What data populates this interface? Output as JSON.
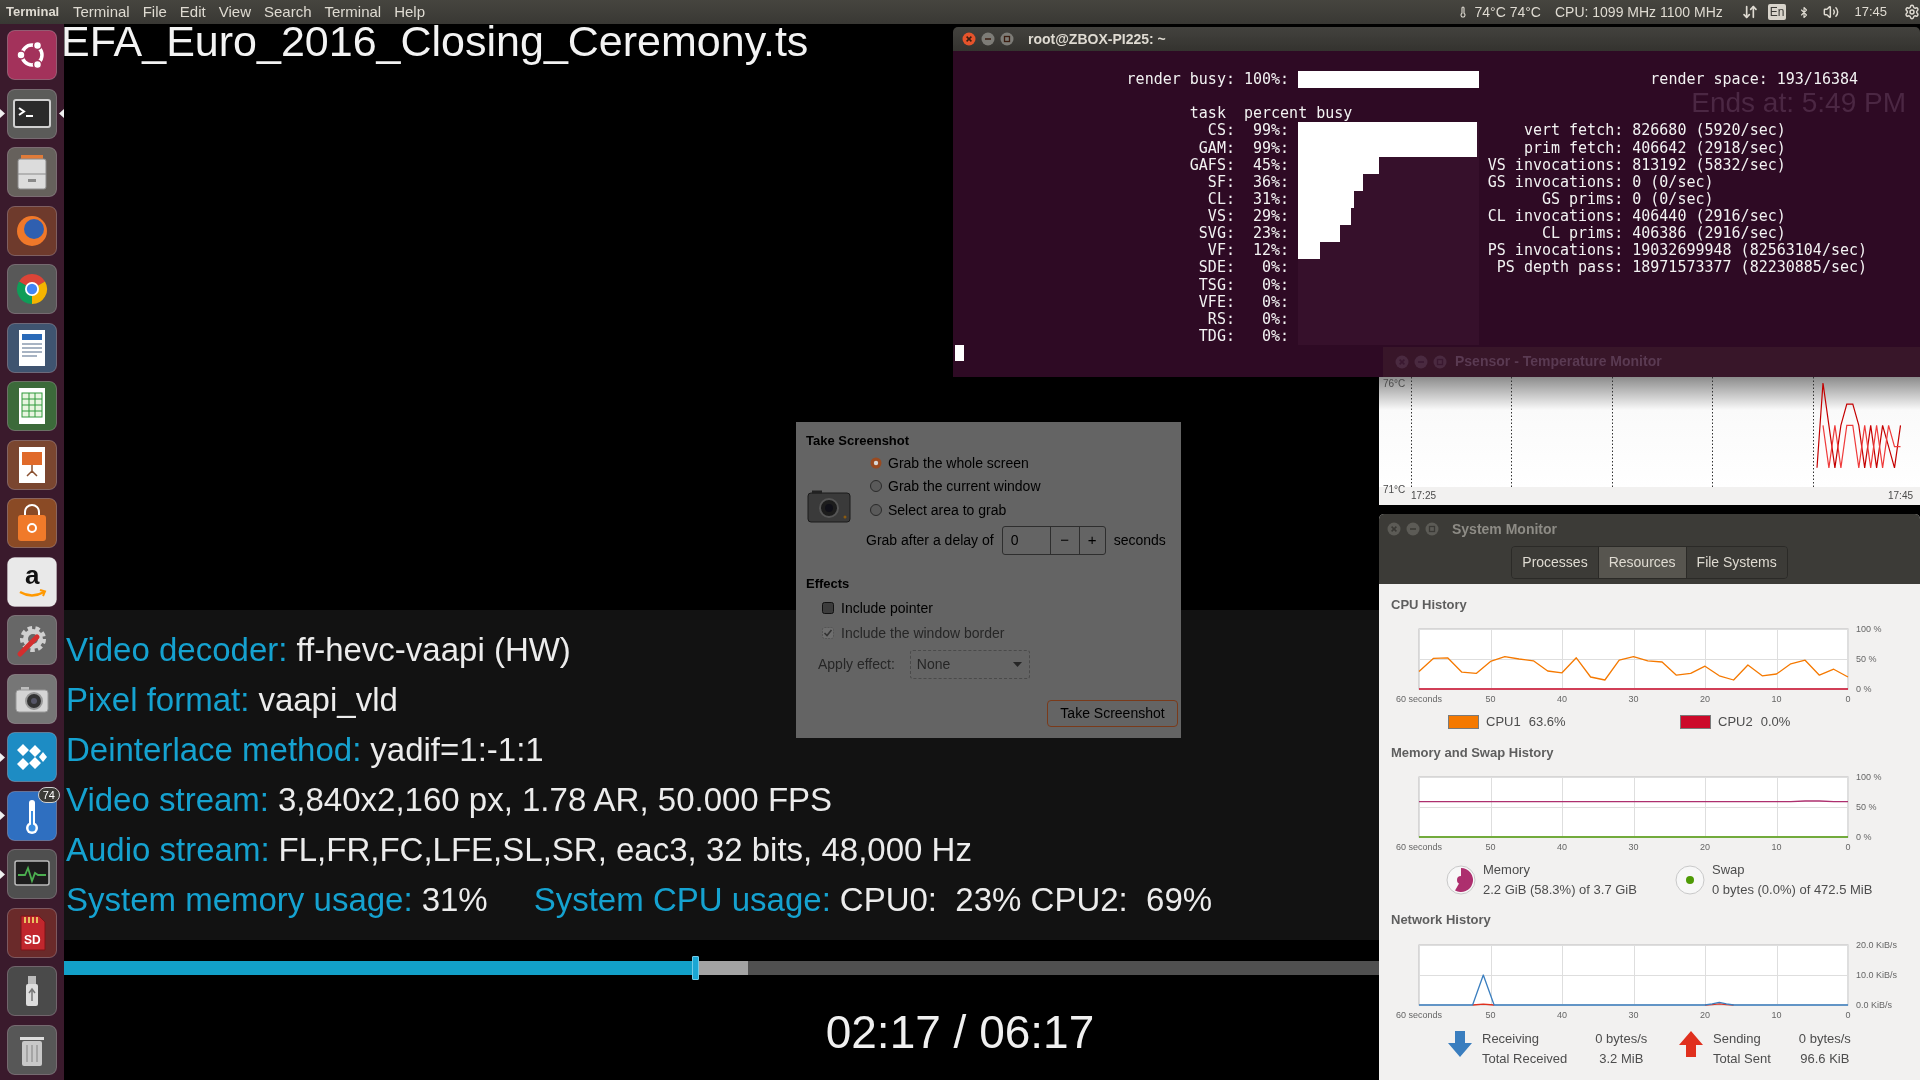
{
  "top_bar": {
    "app_name": "Terminal",
    "menus": [
      "Terminal",
      "File",
      "Edit",
      "View",
      "Search",
      "Terminal",
      "Help"
    ],
    "temperature": "74°C 74°C",
    "cpu_frequency": "CPU: 1099 MHz 1100 MHz",
    "keyboard_layout": "En",
    "clock": "17:45"
  },
  "dock": {
    "items": [
      {
        "kind": "dash",
        "running": false,
        "focused": false
      },
      {
        "kind": "terminal",
        "running": true,
        "focused": true
      },
      {
        "kind": "files",
        "running": false,
        "focused": false
      },
      {
        "kind": "firefox",
        "running": false,
        "focused": false
      },
      {
        "kind": "chrome",
        "running": false,
        "focused": false
      },
      {
        "kind": "writer",
        "running": false,
        "focused": false
      },
      {
        "kind": "calc",
        "running": false,
        "focused": false
      },
      {
        "kind": "impress",
        "running": false,
        "focused": false
      },
      {
        "kind": "software",
        "running": false,
        "focused": false
      },
      {
        "kind": "amazon",
        "running": false,
        "focused": false,
        "glyph": "a"
      },
      {
        "kind": "settings",
        "running": false,
        "focused": false
      },
      {
        "kind": "screenshot",
        "running": false,
        "focused": false
      },
      {
        "kind": "kodi",
        "running": true,
        "focused": false
      },
      {
        "kind": "psensor",
        "running": true,
        "focused": false,
        "badge": "74"
      },
      {
        "kind": "sysmon",
        "running": true,
        "focused": false
      },
      {
        "kind": "sdcard",
        "running": false,
        "focused": false,
        "glyph": "SD"
      },
      {
        "kind": "usb",
        "running": false,
        "focused": false
      },
      {
        "kind": "trash",
        "running": false,
        "focused": false
      }
    ]
  },
  "video": {
    "title": "EFA_Euro_2016_Closing_Ceremony.ts",
    "ends_at": "Ends at: 5:49 PM",
    "info_rows": [
      {
        "items": [
          {
            "label": "Video decoder:",
            "value": "ff-hevc-vaapi (HW)"
          }
        ]
      },
      {
        "items": [
          {
            "label": "Pixel format:",
            "value": "vaapi_vld"
          }
        ]
      },
      {
        "items": [
          {
            "label": "Deinterlace method:",
            "value": "yadif=1:-1:1"
          }
        ]
      },
      {
        "items": [
          {
            "label": "Video stream:",
            "value": "3,840x2,160 px, 1.78 AR, 50.000 FPS"
          }
        ]
      },
      {
        "items": [
          {
            "label": "Audio stream:",
            "value": "FL,FR,FC,LFE,SL,SR, eac3, 32 bits, 48,000 Hz"
          }
        ]
      },
      {
        "items": [
          {
            "label": "System memory usage:",
            "value": "31%"
          },
          {
            "label": "System CPU usage:",
            "value": "CPU0:  23% CPU2:  69%"
          }
        ]
      }
    ],
    "progress": {
      "level": 0.48,
      "buffer": {
        "level": 0.52
      }
    },
    "time": "02:17 / 06:17"
  },
  "screenshot_dialog": {
    "title": "Take Screenshot",
    "grab_options": [
      {
        "label": "Grab the whole screen",
        "selected": true
      },
      {
        "label": "Grab the current window",
        "selected": false
      },
      {
        "label": "Select area to grab",
        "selected": false
      }
    ],
    "delay": {
      "label": "Grab after a delay of",
      "value": "0",
      "decrement": "−",
      "increment": "+",
      "unit": "seconds"
    },
    "effects_title": "Effects",
    "effects": [
      {
        "label": "Include pointer",
        "checked": false,
        "disabled": false
      },
      {
        "label": "Include the window border",
        "checked": true,
        "disabled": true
      }
    ],
    "apply_effect": {
      "label": "Apply effect:",
      "value": "None",
      "disabled": true
    },
    "button": "Take Screenshot"
  },
  "terminal": {
    "title": "root@ZBOX-PI225: ~",
    "active": true,
    "render_busy": {
      "label": "render busy:",
      "percent": "100%:",
      "level": 1
    },
    "render_space": "render space: 193/16384",
    "header": {
      "task": "task",
      "percent": "percent busy"
    },
    "tasks": [
      {
        "name": "CS:",
        "percent": "99%:",
        "level": 0.99
      },
      {
        "name": "GAM:",
        "percent": "99%:",
        "level": 0.99
      },
      {
        "name": "GAFS:",
        "percent": "45%:",
        "level": 0.45
      },
      {
        "name": "SF:",
        "percent": "36%:",
        "level": 0.36
      },
      {
        "name": "CL:",
        "percent": "31%:",
        "level": 0.31
      },
      {
        "name": "VS:",
        "percent": "29%:",
        "level": 0.29
      },
      {
        "name": "SVG:",
        "percent": "23%:",
        "level": 0.23
      },
      {
        "name": "VF:",
        "percent": "12%:",
        "level": 0.12
      },
      {
        "name": "SDE:",
        "percent": "0%:"
      },
      {
        "name": "TSG:",
        "percent": "0%:"
      },
      {
        "name": "VFE:",
        "percent": "0%:"
      },
      {
        "name": "RS:",
        "percent": "0%:"
      },
      {
        "name": "TDG:",
        "percent": "0%:"
      }
    ],
    "stats": [
      {
        "label": "vert fetch:",
        "value": "826680 (5920/sec)"
      },
      {
        "label": "prim fetch:",
        "value": "406642 (2918/sec)"
      },
      {
        "label": "VS invocations:",
        "value": "813192 (5832/sec)"
      },
      {
        "label": "GS invocations:",
        "value": "0 (0/sec)"
      },
      {
        "label": "GS prims:",
        "value": "0 (0/sec)"
      },
      {
        "label": "CL invocations:",
        "value": "406440 (2916/sec)"
      },
      {
        "label": "CL prims:",
        "value": "406386 (2916/sec)"
      },
      {
        "label": "PS invocations:",
        "value": "19032699948 (82563104/sec)"
      },
      {
        "label": "PS depth pass:",
        "value": "18971573377 (82230885/sec)"
      }
    ]
  },
  "psensor": {
    "title": "Psensor - Temperature Monitor",
    "chart_data": {
      "type": "line",
      "grid": true,
      "categories": [
        "17:25",
        null,
        null,
        null,
        null,
        null,
        null,
        null,
        null,
        null,
        null,
        null,
        null,
        null,
        null,
        null,
        null,
        null,
        null,
        null,
        null,
        null,
        null,
        null,
        null,
        null,
        null,
        null,
        null,
        null,
        null,
        null,
        null,
        null,
        null,
        null,
        null,
        null,
        null,
        null,
        null,
        null,
        null,
        null,
        null,
        null,
        null,
        null,
        null,
        null,
        null,
        null,
        null,
        null,
        null,
        null,
        null,
        null,
        null,
        null,
        null,
        null,
        null,
        null,
        null,
        null,
        null,
        null,
        null,
        null,
        null,
        null,
        null,
        null,
        null,
        null,
        null,
        null,
        null,
        null,
        "17:45"
      ],
      "series": [
        {
          "color": "#c40000",
          "values": [
            null,
            null,
            null,
            null,
            null,
            null,
            null,
            null,
            null,
            null,
            null,
            null,
            null,
            null,
            null,
            null,
            null,
            null,
            null,
            null,
            null,
            null,
            null,
            null,
            null,
            null,
            null,
            null,
            null,
            null,
            null,
            null,
            null,
            null,
            null,
            null,
            null,
            null,
            null,
            null,
            null,
            null,
            null,
            null,
            null,
            null,
            null,
            null,
            null,
            null,
            null,
            null,
            null,
            null,
            null,
            null,
            null,
            null,
            null,
            null,
            null,
            null,
            null,
            null,
            null,
            null,
            72,
            76,
            74,
            72,
            74,
            75,
            75,
            74,
            72,
            74,
            72,
            74,
            73,
            72,
            74
          ]
        },
        {
          "color": "#ef3b3b",
          "values": [
            null,
            null,
            null,
            null,
            null,
            null,
            null,
            null,
            null,
            null,
            null,
            null,
            null,
            null,
            null,
            null,
            null,
            null,
            null,
            null,
            null,
            null,
            null,
            null,
            null,
            null,
            null,
            null,
            null,
            null,
            null,
            null,
            null,
            null,
            null,
            null,
            null,
            null,
            null,
            null,
            null,
            null,
            null,
            null,
            null,
            null,
            null,
            null,
            null,
            null,
            null,
            null,
            null,
            null,
            null,
            null,
            null,
            null,
            null,
            null,
            null,
            null,
            null,
            null,
            null,
            null,
            null,
            74,
            72,
            74,
            72,
            74,
            74,
            72,
            74,
            72,
            74,
            72,
            74,
            73,
            73
          ]
        }
      ],
      "ylim": [
        71,
        76
      ],
      "yticks": [
        {
          "value": 71,
          "label": "71°C"
        },
        {
          "value": 76,
          "label": "76°C"
        }
      ]
    }
  },
  "system_monitor": {
    "title": "System Monitor",
    "active": false,
    "tabs": [
      {
        "label": "Processes",
        "selected": false
      },
      {
        "label": "Resources",
        "selected": true
      },
      {
        "label": "File Systems",
        "selected": false
      }
    ],
    "sections": [
      {
        "kind": "cpu",
        "title": "CPU History",
        "chart_data": {
          "type": "line",
          "grid": true,
          "x": [
            60,
            58,
            56,
            54,
            52,
            50,
            48,
            46,
            44,
            42,
            40,
            38,
            36,
            34,
            32,
            30,
            28,
            26,
            24,
            22,
            20,
            18,
            16,
            14,
            12,
            10,
            8,
            6,
            4,
            2,
            0
          ],
          "series": [
            {
              "name": "CPU1",
              "color": "#f57900",
              "values": [
                29,
                51,
                52,
                28,
                26,
                46,
                54,
                50,
                47,
                30,
                27,
                52,
                20,
                15,
                48,
                54,
                47,
                45,
                23,
                26,
                38,
                22,
                15,
                40,
                22,
                25,
                42,
                48,
                23,
                33,
                20
              ]
            },
            {
              "name": "CPU2",
              "color": "#cc0a2a",
              "values": [
                0,
                0,
                0,
                0,
                0,
                0,
                0,
                0,
                0,
                0,
                0,
                0,
                0,
                0,
                0,
                0,
                0,
                0,
                0,
                0,
                0,
                0,
                0,
                0,
                0,
                0,
                0,
                0,
                0,
                0,
                0
              ]
            }
          ],
          "xlim": [
            60,
            0
          ],
          "ylim": [
            0,
            100
          ],
          "xticks": [
            {
              "value": 60,
              "label": "60 seconds"
            },
            {
              "value": 50,
              "label": "50"
            },
            {
              "value": 40,
              "label": "40"
            },
            {
              "value": 30,
              "label": "30"
            },
            {
              "value": 20,
              "label": "20"
            },
            {
              "value": 10,
              "label": "10"
            },
            {
              "value": 0,
              "label": "0"
            }
          ],
          "yticks": [
            {
              "value": 0,
              "label": "0 %"
            },
            {
              "value": 50,
              "label": "50 %"
            },
            {
              "value": 100,
              "label": "100 %"
            }
          ]
        },
        "legend": [
          {
            "kind": "swatch",
            "value": "63.6%"
          },
          {
            "kind": "swatch",
            "value": "0.0%"
          }
        ]
      },
      {
        "kind": "memory",
        "title": "Memory and Swap History",
        "chart_data": {
          "type": "line",
          "grid": true,
          "x": [
            60,
            58,
            56,
            54,
            52,
            50,
            48,
            46,
            44,
            42,
            40,
            38,
            36,
            34,
            32,
            30,
            28,
            26,
            24,
            22,
            20,
            18,
            16,
            14,
            12,
            10,
            8,
            6,
            4,
            2,
            0
          ],
          "series": [
            {
              "name": "Memory",
              "color": "#ad2f6e",
              "values": [
                59,
                59,
                59,
                59,
                59,
                59,
                59,
                59,
                59,
                59,
                59,
                59,
                59,
                59,
                59,
                59,
                59,
                59,
                59,
                59,
                59,
                59,
                59,
                59,
                59,
                59,
                59,
                60,
                60,
                59,
                59
              ]
            },
            {
              "name": "Swap",
              "color": "#4e9a06",
              "values": [
                0,
                0,
                0,
                0,
                0,
                0,
                0,
                0,
                0,
                0,
                0,
                0,
                0,
                0,
                0,
                0,
                0,
                0,
                0,
                0,
                0,
                0,
                0,
                0,
                0,
                0,
                0,
                0,
                0,
                0,
                0
              ]
            }
          ],
          "xlim": [
            60,
            0
          ],
          "ylim": [
            0,
            100
          ],
          "xticks": [
            {
              "value": 60,
              "label": "60 seconds"
            },
            {
              "value": 50,
              "label": "50"
            },
            {
              "value": 40,
              "label": "40"
            },
            {
              "value": 30,
              "label": "30"
            },
            {
              "value": 20,
              "label": "20"
            },
            {
              "value": 10,
              "label": "10"
            },
            {
              "value": 0,
              "label": "0"
            }
          ],
          "yticks": [
            {
              "value": 0,
              "label": "0 %"
            },
            {
              "value": 50,
              "label": "50 %"
            },
            {
              "value": 100,
              "label": "100 %"
            }
          ]
        },
        "legend": [
          {
            "kind": "pie",
            "value": "2.2 GiB (58.3%) of 3.7 GiB",
            "level": 0.583
          },
          {
            "kind": "pie",
            "value": "0 bytes (0.0%) of 472.5 MiB"
          }
        ]
      },
      {
        "kind": "network",
        "title": "Network History",
        "chart_data": {
          "type": "line",
          "grid": true,
          "x": [
            60,
            55,
            52.5,
            51,
            49.5,
            45,
            40,
            35,
            30,
            25,
            20,
            19,
            18,
            17,
            16,
            10,
            5,
            0
          ],
          "series": [
            {
              "name": "Receiving",
              "color": "#3a7ebf",
              "values": [
                0,
                0,
                0,
                10,
                0,
                0,
                0,
                0,
                0,
                0,
                0,
                0.4,
                0.9,
                0.4,
                0,
                0,
                0,
                0
              ]
            },
            {
              "name": "Sending",
              "color": "#e0301e",
              "values": [
                null,
                null,
                0,
                0.3,
                0,
                null,
                null,
                null,
                null,
                null,
                0,
                0.1,
                0.4,
                0.1,
                0,
                null,
                null,
                null
              ]
            }
          ],
          "xlim": [
            60,
            0
          ],
          "ylim": [
            0,
            20
          ],
          "xticks": [
            {
              "value": 60,
              "label": "60 seconds"
            },
            {
              "value": 50,
              "label": "50"
            },
            {
              "value": 40,
              "label": "40"
            },
            {
              "value": 30,
              "label": "30"
            },
            {
              "value": 20,
              "label": "20"
            },
            {
              "value": 10,
              "label": "10"
            },
            {
              "value": 0,
              "label": "0"
            }
          ],
          "yticks": [
            {
              "value": 0,
              "label": "0.0 KiB/s"
            },
            {
              "value": 10,
              "label": "10.0 KiB/s"
            },
            {
              "value": 20,
              "label": "20.0 KiB/s"
            }
          ]
        },
        "legend": [
          {
            "kind": "receive",
            "value": "0 bytes/s",
            "total_label": "Total Received",
            "total": "3.2 MiB"
          },
          {
            "kind": "send",
            "value": "0 bytes/s",
            "total_label": "Total Sent",
            "total": "96.6 KiB"
          }
        ]
      }
    ]
  }
}
